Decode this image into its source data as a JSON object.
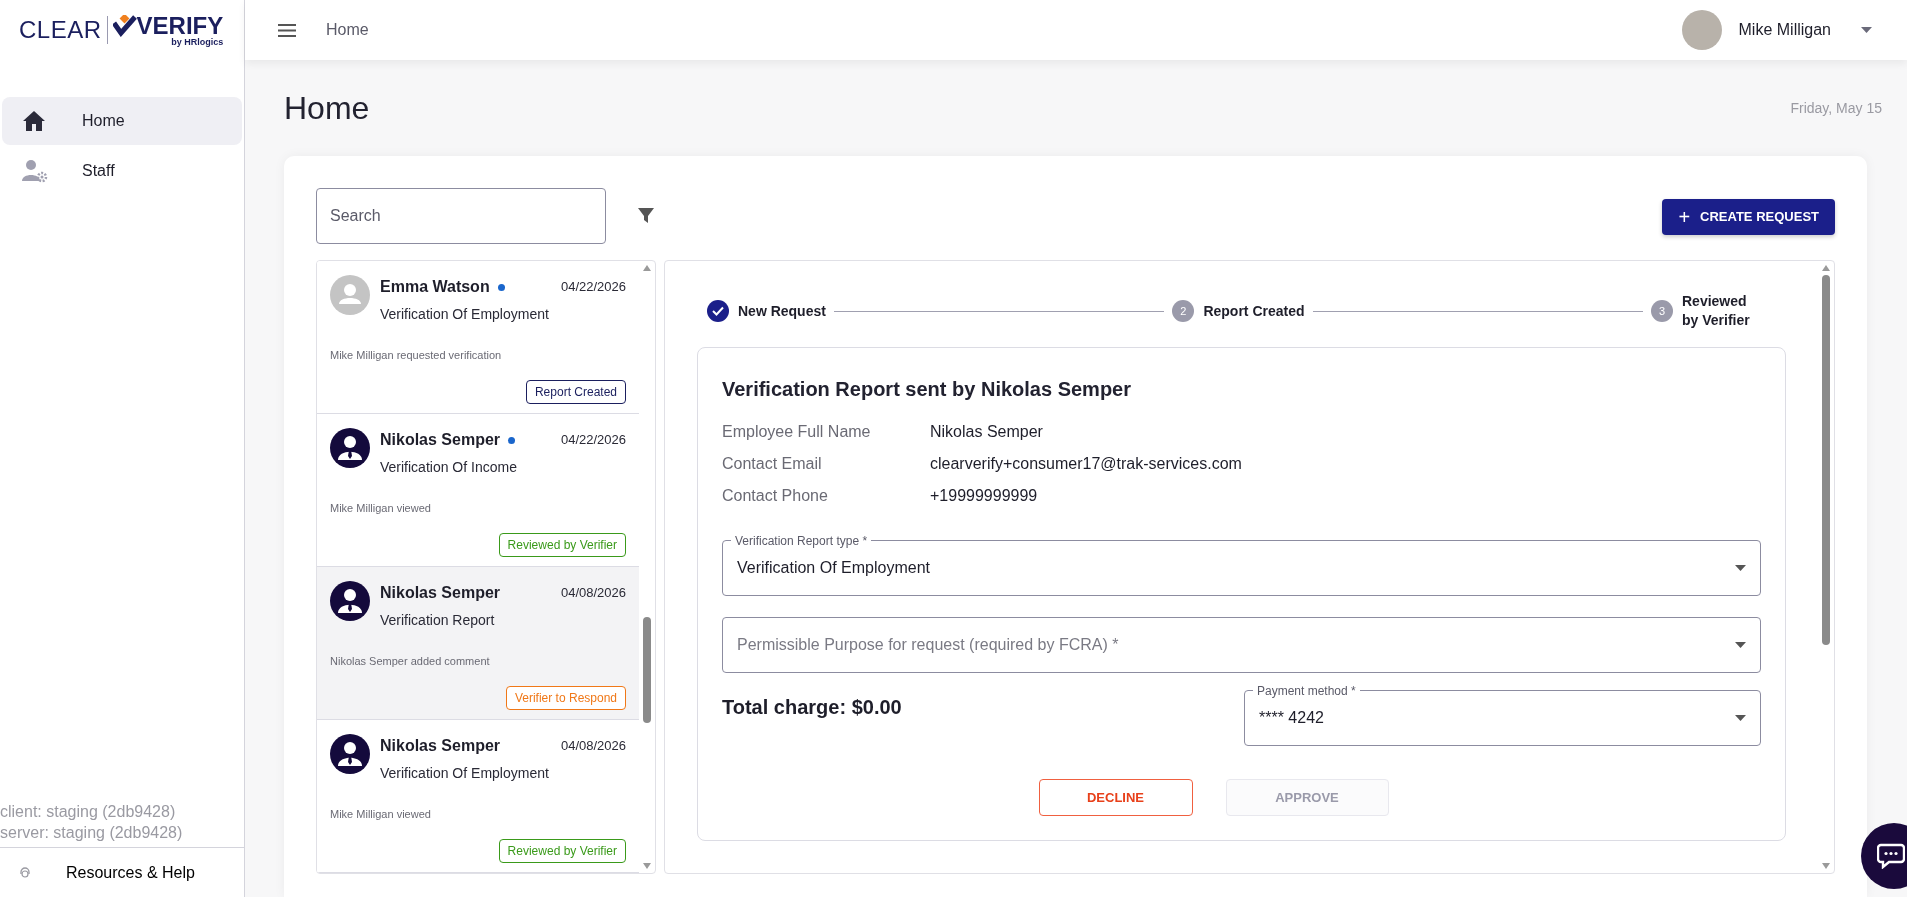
{
  "logo": {
    "word_1": "CLEAR",
    "word_2": "VERIFY",
    "tagline": "by HRlogics"
  },
  "sidebar": {
    "items": [
      {
        "label": "Home",
        "kind": "home",
        "selected": true
      },
      {
        "label": "Staff",
        "kind": "staff",
        "selected": false
      }
    ],
    "version_lines": [
      "client: staging (2db9428)",
      "server: staging (2db9428)"
    ],
    "help": {
      "label": "Resources & Help"
    }
  },
  "header": {
    "breadcrumb": "Home",
    "user": {
      "name": "Mike Milligan"
    }
  },
  "page": {
    "title": "Home",
    "date": "Friday, May 15"
  },
  "search": {
    "placeholder": "Search"
  },
  "create_button": {
    "icon": "+",
    "label": "CREATE REQUEST"
  },
  "requests": [
    {
      "name": "Emma Watson",
      "unread": true,
      "kind": "placeholder",
      "date": "04/22/2026",
      "type": "Verification Of Employment",
      "activity": "Mike Milligan requested verification",
      "status": "Report Created",
      "color": "#1b1f5e",
      "selected": false
    },
    {
      "name": "Nikolas Semper",
      "unread": true,
      "kind": "person",
      "date": "04/22/2026",
      "type": "Verification Of Income",
      "activity": "Mike Milligan viewed",
      "status": "Reviewed by Verifier",
      "color": "#3a9a1a",
      "selected": false
    },
    {
      "name": "Nikolas Semper",
      "unread": false,
      "kind": "person",
      "date": "04/08/2026",
      "type": "Verification Report",
      "activity": "Nikolas Semper added comment",
      "status": "Verifier to Respond",
      "color": "#f07818",
      "selected": true
    },
    {
      "name": "Nikolas Semper",
      "unread": false,
      "kind": "person",
      "date": "04/08/2026",
      "type": "Verification Of Employment",
      "activity": "Mike Milligan viewed",
      "status": "Reviewed by Verifier",
      "color": "#3a9a1a",
      "selected": false
    }
  ],
  "stepper": [
    {
      "label": "New Request",
      "completed": true
    },
    {
      "number": "2",
      "label": "Report Created",
      "completed": false
    },
    {
      "number": "3",
      "label": "Reviewed by Verifier",
      "completed": false
    }
  ],
  "report": {
    "title": "Verification Report sent by Nikolas Semper",
    "details": [
      {
        "label": "Employee Full Name",
        "value": "Nikolas Semper"
      },
      {
        "label": "Contact Email",
        "value": "clearverify+consumer17@trak-services.com"
      },
      {
        "label": "Contact Phone",
        "value": "+19999999999"
      }
    ],
    "report_type": {
      "label": "Verification Report type *",
      "value": "Verification Of Employment"
    },
    "purpose": {
      "placeholder": "Permissible Purpose for request (required by FCRA) *"
    },
    "total_charge": "Total charge: $0.00",
    "payment_method": {
      "label": "Payment method *",
      "value": "**** 4242"
    },
    "buttons": [
      {
        "label": "DECLINE",
        "kind": "decline",
        "disabled": false
      },
      {
        "label": "APPROVE",
        "kind": "approve",
        "disabled": true
      }
    ]
  }
}
